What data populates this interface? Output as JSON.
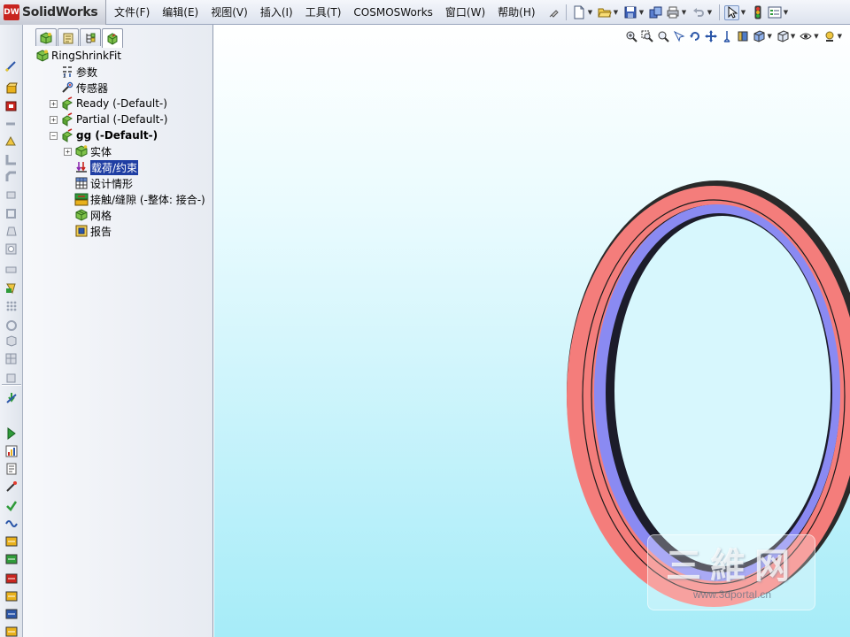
{
  "app": {
    "brand_badge": "DW",
    "brand_name": "SolidWorks"
  },
  "menu": {
    "items": [
      "文件(F)",
      "编辑(E)",
      "视图(V)",
      "插入(I)",
      "工具(T)",
      "COSMOSWorks",
      "窗口(W)",
      "帮助(H)"
    ]
  },
  "toolbar": {
    "icons": [
      "pin-icon",
      "new-document-icon",
      "open-folder-icon",
      "save-icon",
      "copy-icon",
      "print-icon",
      "undo-icon",
      "select-arrow-icon",
      "traffic-light-icon",
      "options-icon"
    ]
  },
  "command_manager": {
    "icons": [
      "sketch-icon",
      "extrude-boss-icon",
      "revolve-icon",
      "sweep-icon",
      "loft-icon",
      "fillet-icon",
      "chamfer-icon",
      "rib-icon",
      "shell-icon",
      "draft-icon",
      "hole-icon",
      "linear-pattern-icon",
      "mirror-icon",
      "reference-geometry-icon",
      "curves-icon",
      "study-icon",
      "mesh-icon",
      "fixture-icon",
      "load-icon",
      "run-icon",
      "result-icon",
      "report-icon",
      "probe-icon",
      "design-check-icon",
      "fatigue-icon"
    ]
  },
  "feature_manager": {
    "tabs": [
      "cosmosworks-tab-icon",
      "property-manager-tab-icon",
      "configuration-tab-icon",
      "simulation-tab-icon"
    ],
    "tree": [
      {
        "label": "RingShrinkFit",
        "icon": "part-icon",
        "level": 0,
        "expander": "",
        "bold": false,
        "selected": false
      },
      {
        "label": "参数",
        "icon": "parameters-icon",
        "level": 1,
        "expander": "",
        "bold": false,
        "selected": false
      },
      {
        "label": "传感器",
        "icon": "sensor-icon",
        "level": 1,
        "expander": "",
        "bold": false,
        "selected": false
      },
      {
        "label": "Ready (-Default-)",
        "icon": "static-study-icon",
        "level": 1,
        "expander": "+",
        "bold": false,
        "selected": false
      },
      {
        "label": "Partial (-Default-)",
        "icon": "static-study-icon",
        "level": 1,
        "expander": "+",
        "bold": false,
        "selected": false
      },
      {
        "label": "gg (-Default-)",
        "icon": "static-study-icon",
        "level": 1,
        "expander": "−",
        "bold": true,
        "selected": false
      },
      {
        "label": "实体",
        "icon": "solid-body-icon",
        "level": 2,
        "expander": "+",
        "bold": false,
        "selected": false
      },
      {
        "label": "载荷/约束",
        "icon": "load-restraint-icon",
        "level": 2,
        "expander": "",
        "bold": false,
        "selected": true
      },
      {
        "label": "设计情形",
        "icon": "design-scenario-icon",
        "level": 2,
        "expander": "",
        "bold": false,
        "selected": false
      },
      {
        "label": "接触/缝隙 (-整体: 接合-)",
        "icon": "contact-gap-icon",
        "level": 2,
        "expander": "",
        "bold": false,
        "selected": false
      },
      {
        "label": "网格",
        "icon": "mesh-icon",
        "level": 2,
        "expander": "",
        "bold": false,
        "selected": false
      },
      {
        "label": "报告",
        "icon": "report-icon",
        "level": 2,
        "expander": "",
        "bold": false,
        "selected": false
      }
    ]
  },
  "view_toolbar": {
    "icons": [
      "zoom-to-fit-icon",
      "zoom-window-icon",
      "zoom-in-out-icon",
      "zoom-selection-icon",
      "rotate-view-icon",
      "pan-icon",
      "standard-views-icon",
      "section-view-icon",
      "display-style-icon",
      "view-orientation-icon",
      "hide-show-icon",
      "edit-appearance-icon",
      "apply-scene-icon"
    ]
  },
  "colors": {
    "ring_outer": "#f47d7b",
    "ring_inner": "#8a8af2",
    "selection": "#1f3ea3",
    "viewport_bottom": "#a6ecf8"
  },
  "watermark": {
    "title": "三維网",
    "url": "www.3dportal.cn"
  }
}
